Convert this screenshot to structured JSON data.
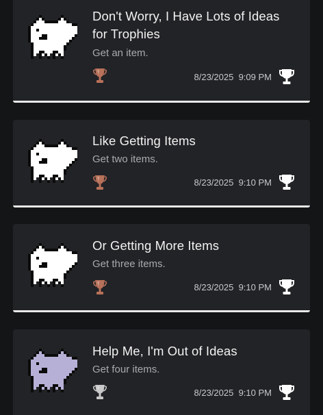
{
  "trophies": [
    {
      "title_line1": "Don't Worry, I Have Lots of Ideas",
      "title_line2": "for Trophies",
      "description": "Get an item.",
      "date": "8/23/2025",
      "time": "9:09 PM",
      "grade": "bronze",
      "dog_color": "#ffffff",
      "grade_icon": "bronze-trophy-icon"
    },
    {
      "title_line1": "Like Getting Items",
      "title_line2": "",
      "description": "Get two items.",
      "date": "8/23/2025",
      "time": "9:10 PM",
      "grade": "bronze",
      "dog_color": "#ffffff",
      "grade_icon": "bronze-trophy-icon"
    },
    {
      "title_line1": "Or Getting More Items",
      "title_line2": "",
      "description": "Get three items.",
      "date": "8/23/2025",
      "time": "9:10 PM",
      "grade": "bronze",
      "dog_color": "#ffffff",
      "grade_icon": "bronze-trophy-icon"
    },
    {
      "title_line1": "Help Me, I'm Out of Ideas",
      "title_line2": "",
      "description": "Get four items.",
      "date": "8/23/2025",
      "time": "9:10 PM",
      "grade": "silver",
      "dog_color": "#b7b0d6",
      "grade_icon": "silver-trophy-icon"
    }
  ],
  "colors": {
    "bronze": "#b8715a",
    "silver": "#c9c9c9",
    "card_bg": "#222326",
    "background": "#141517"
  },
  "icons": {
    "earned": "white-trophy-icon",
    "thumbnail": "annoying-dog-icon"
  }
}
